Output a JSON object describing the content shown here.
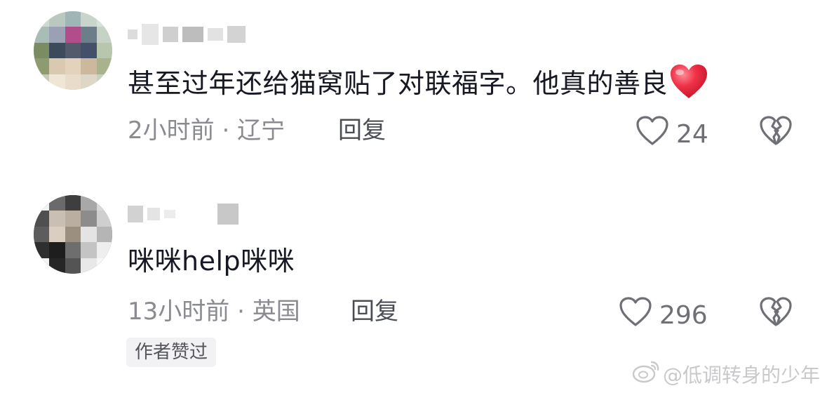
{
  "comments": [
    {
      "content": "甚至过年还给猫窝贴了对联福字。他真的善良",
      "time": "2小时前",
      "separator": "·",
      "location": "辽宁",
      "reply_label": "回复",
      "likes": "24",
      "heart_emoji": "red-heart-emoji"
    },
    {
      "content": "咪咪help咪咪",
      "time": "13小时前",
      "separator": "·",
      "location": "英国",
      "reply_label": "回复",
      "likes": "296",
      "badge": "作者赞过"
    }
  ],
  "watermark": {
    "text": "@低调转身的少年",
    "icon": "weibo-icon"
  },
  "colors": {
    "text_primary": "#161823",
    "text_meta": "#8a8b91",
    "heart_red": "#e8243c",
    "badge_bg": "#f2f2f4"
  }
}
